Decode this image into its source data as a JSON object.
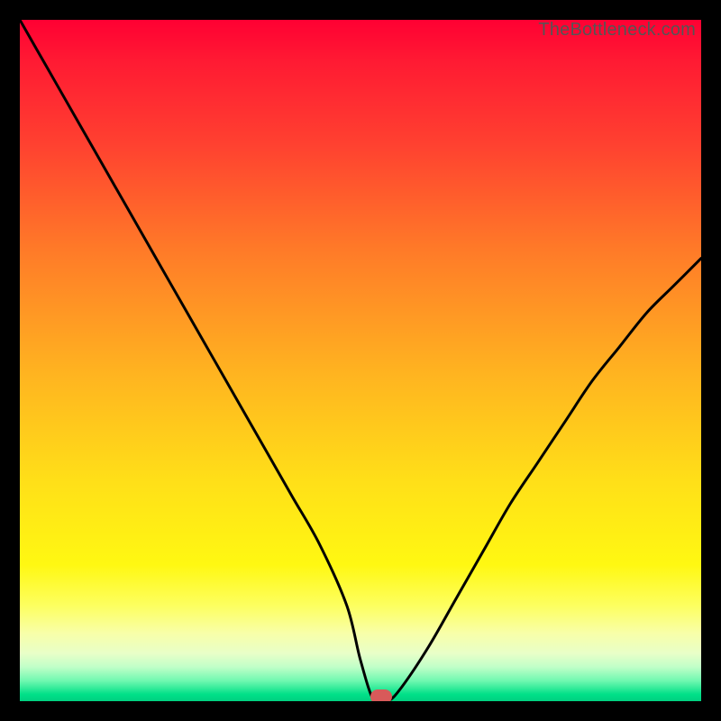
{
  "watermark": "TheBottleneck.com",
  "colors": {
    "frame": "#000000",
    "curve": "#000000",
    "marker": "#d85a5a"
  },
  "chart_data": {
    "type": "line",
    "title": "",
    "xlabel": "",
    "ylabel": "",
    "xlim": [
      0,
      100
    ],
    "ylim": [
      0,
      100
    ],
    "series": [
      {
        "name": "bottleneck-curve",
        "x": [
          0,
          4,
          8,
          12,
          16,
          20,
          24,
          28,
          32,
          36,
          40,
          44,
          48,
          50,
          52,
          54,
          56,
          60,
          64,
          68,
          72,
          76,
          80,
          84,
          88,
          92,
          96,
          100
        ],
        "y": [
          100,
          93,
          86,
          79,
          72,
          65,
          58,
          51,
          44,
          37,
          30,
          23,
          14,
          6,
          0,
          0,
          2,
          8,
          15,
          22,
          29,
          35,
          41,
          47,
          52,
          57,
          61,
          65
        ]
      }
    ],
    "marker": {
      "x": 53,
      "y": 0
    }
  }
}
